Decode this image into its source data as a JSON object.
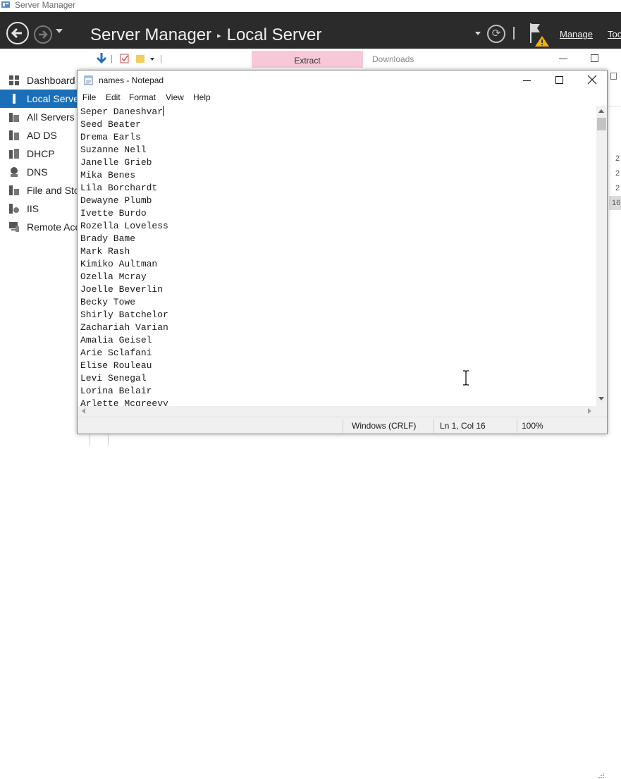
{
  "server_manager": {
    "window_title": "Server Manager",
    "breadcrumb_root": "Server Manager",
    "breadcrumb_separator": "▸",
    "breadcrumb_current": "Local Server",
    "menu_manage": "Manage",
    "menu_tools": "Too",
    "sidebar": [
      {
        "label": "Dashboard",
        "icon": "dashboard-icon",
        "active": false
      },
      {
        "label": "Local Server",
        "icon": "local-server-icon",
        "active": true
      },
      {
        "label": "All Servers",
        "icon": "all-servers-icon",
        "active": false
      },
      {
        "label": "AD DS",
        "icon": "ad-ds-icon",
        "active": false
      },
      {
        "label": "DHCP",
        "icon": "dhcp-icon",
        "active": false
      },
      {
        "label": "DNS",
        "icon": "dns-icon",
        "active": false
      },
      {
        "label": "File and Sto",
        "icon": "file-storage-icon",
        "active": false
      },
      {
        "label": "IIS",
        "icon": "iis-icon",
        "active": false
      },
      {
        "label": "Remote Acc",
        "icon": "remote-access-icon",
        "active": false
      }
    ],
    "accent_color": "#1b6fb8",
    "header_color": "#2b2b2b"
  },
  "explorer": {
    "extract_tab": "Extract",
    "downloads_label": "Downloads",
    "right_column_values": [
      "2",
      "2",
      "2",
      "16"
    ]
  },
  "notepad": {
    "title": "names - Notepad",
    "menu": [
      "File",
      "Edit",
      "Format",
      "View",
      "Help"
    ],
    "lines": [
      "Seper Daneshvar",
      "Seed Beater",
      "Drema Earls",
      "Suzanne Nell",
      "Janelle Grieb",
      "Mika Benes",
      "Lila Borchardt",
      "Dewayne Plumb",
      "Ivette Burdo",
      "Rozella Loveless",
      "Brady Bame",
      "Mark Rash",
      "Kimiko Aultman",
      "Ozella Mcray",
      "Joelle Beverlin",
      "Becky Towe",
      "Shirly Batchelor",
      "Zachariah Varian",
      "Amalia Geisel",
      "Arie Sclafani",
      "Elise Rouleau",
      "Levi Senegal",
      "Lorina Belair",
      "Arlette Mcgreevy"
    ],
    "status": {
      "line_ending": "Windows (CRLF)",
      "position": "Ln 1, Col 16",
      "zoom": "100%"
    }
  }
}
